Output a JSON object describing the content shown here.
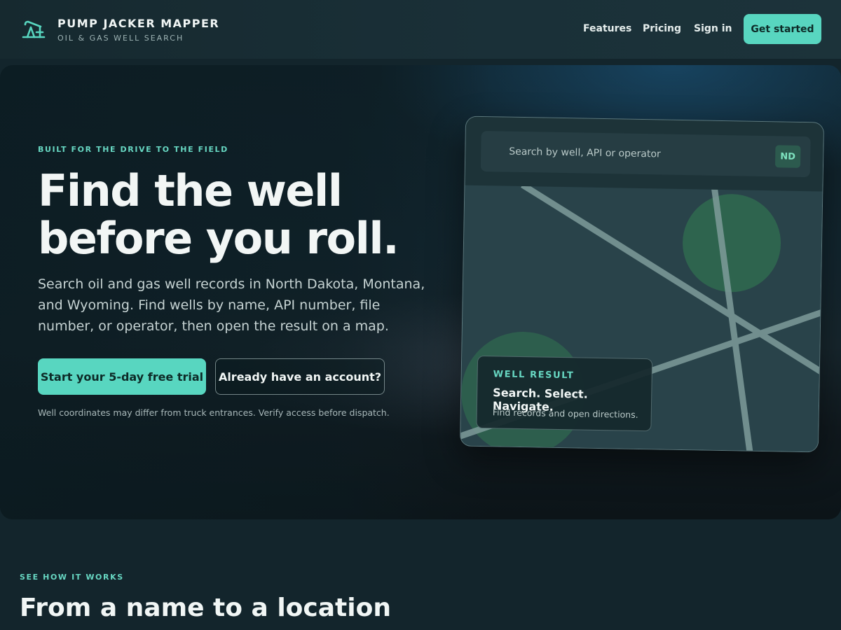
{
  "brand": {
    "name": "PUMP JACKER MAPPER",
    "tagline": "OIL & GAS WELL SEARCH",
    "logo_icon": "pump-jack-icon",
    "accent_color": "#58d6c0"
  },
  "nav": {
    "items": [
      {
        "label": "Features"
      },
      {
        "label": "Pricing"
      },
      {
        "label": "Sign in"
      }
    ],
    "cta_label": "Get started"
  },
  "hero": {
    "eyebrow": "BUILT FOR THE DRIVE TO THE FIELD",
    "headline_line1": "Find the well",
    "headline_line2": "before you roll.",
    "lede": "Search oil and gas well records in North Dakota, Montana, and Wyoming. Find wells by name, API number, file number, or operator, then open the result on a map.",
    "primary_cta": "Start your 5-day free trial",
    "secondary_cta": "Already have an account?",
    "disclaimer": "Well coordinates may differ from truck entrances. Verify access before dispatch."
  },
  "map_preview": {
    "search_placeholder": "Search by well, API or operator",
    "state_badge": "ND",
    "result": {
      "kicker": "WELL RESULT",
      "title": "Search. Select. Navigate.",
      "description": "Find records and open directions."
    }
  },
  "how_it_works": {
    "eyebrow": "SEE HOW IT WORKS",
    "title": "From a name to a location"
  }
}
